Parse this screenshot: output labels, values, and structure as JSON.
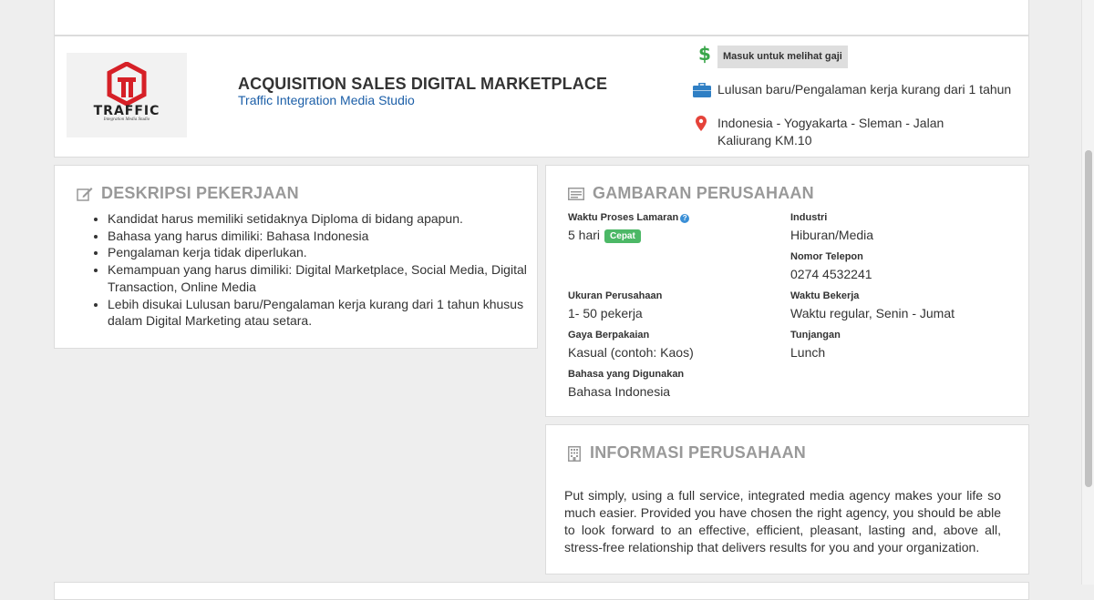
{
  "header": {
    "logo_word": "TRAFFIC",
    "logo_subtitle": "Integration Media Studio",
    "job_title": "ACQUISITION SALES DIGITAL MARKETPLACE",
    "company": "Traffic Integration Media Studio",
    "salary_badge": "Masuk untuk melihat gaji",
    "experience": "Lulusan baru/Pengalaman kerja kurang dari 1 tahun",
    "location": "Indonesia - Yogyakarta - Sleman - Jalan Kaliurang KM.10"
  },
  "description": {
    "title": "DESKRIPSI PEKERJAAN",
    "items": [
      "Kandidat harus memiliki setidaknya Diploma di bidang apapun.",
      "Bahasa yang harus dimiliki: Bahasa Indonesia",
      "Pengalaman kerja tidak diperlukan.",
      "Kemampuan yang harus dimiliki: Digital Marketplace, Social Media, Digital Transaction, Online Media",
      "Lebih disukai Lulusan baru/Pengalaman kerja kurang dari 1 tahun khusus dalam Digital Marketing atau setara."
    ]
  },
  "overview": {
    "title": "GAMBARAN PERUSAHAAN",
    "processing_label": "Waktu Proses Lamaran",
    "processing_value": "5 hari",
    "processing_badge": "Cepat",
    "help_glyph": "?",
    "industry_label": "Industri",
    "industry_value": "Hiburan/Media",
    "phone_label": "Nomor Telepon",
    "phone_value": "0274 4532241",
    "size_label": "Ukuran Perusahaan",
    "size_value": "1- 50 pekerja",
    "hours_label": "Waktu Bekerja",
    "hours_value": "Waktu regular, Senin - Jumat",
    "dress_label": "Gaya Berpakaian",
    "dress_value": "Kasual (contoh: Kaos)",
    "benefits_label": "Tunjangan",
    "benefits_value": "Lunch",
    "language_label": "Bahasa yang Digunakan",
    "language_value": "Bahasa Indonesia"
  },
  "info": {
    "title": "INFORMASI PERUSAHAAN",
    "text": "Put simply, using a full service, integrated media agency makes your life so much easier. Provided you have chosen the right agency, you should be able to look forward to an effective, efficient, pleasant, lasting and, above all, stress-free relationship that delivers results for you and your organization."
  },
  "colors": {
    "logo_red": "#d62027",
    "salary_green": "#3aa64a",
    "briefcase_blue": "#2f7fc4",
    "pin_red": "#e5433a",
    "link_blue": "#1c5fa8",
    "badge_green": "#4cb866"
  },
  "icons": [
    "dollar-icon",
    "briefcase-icon",
    "location-pin-icon",
    "edit-icon",
    "card-icon",
    "building-icon",
    "help-icon"
  ]
}
